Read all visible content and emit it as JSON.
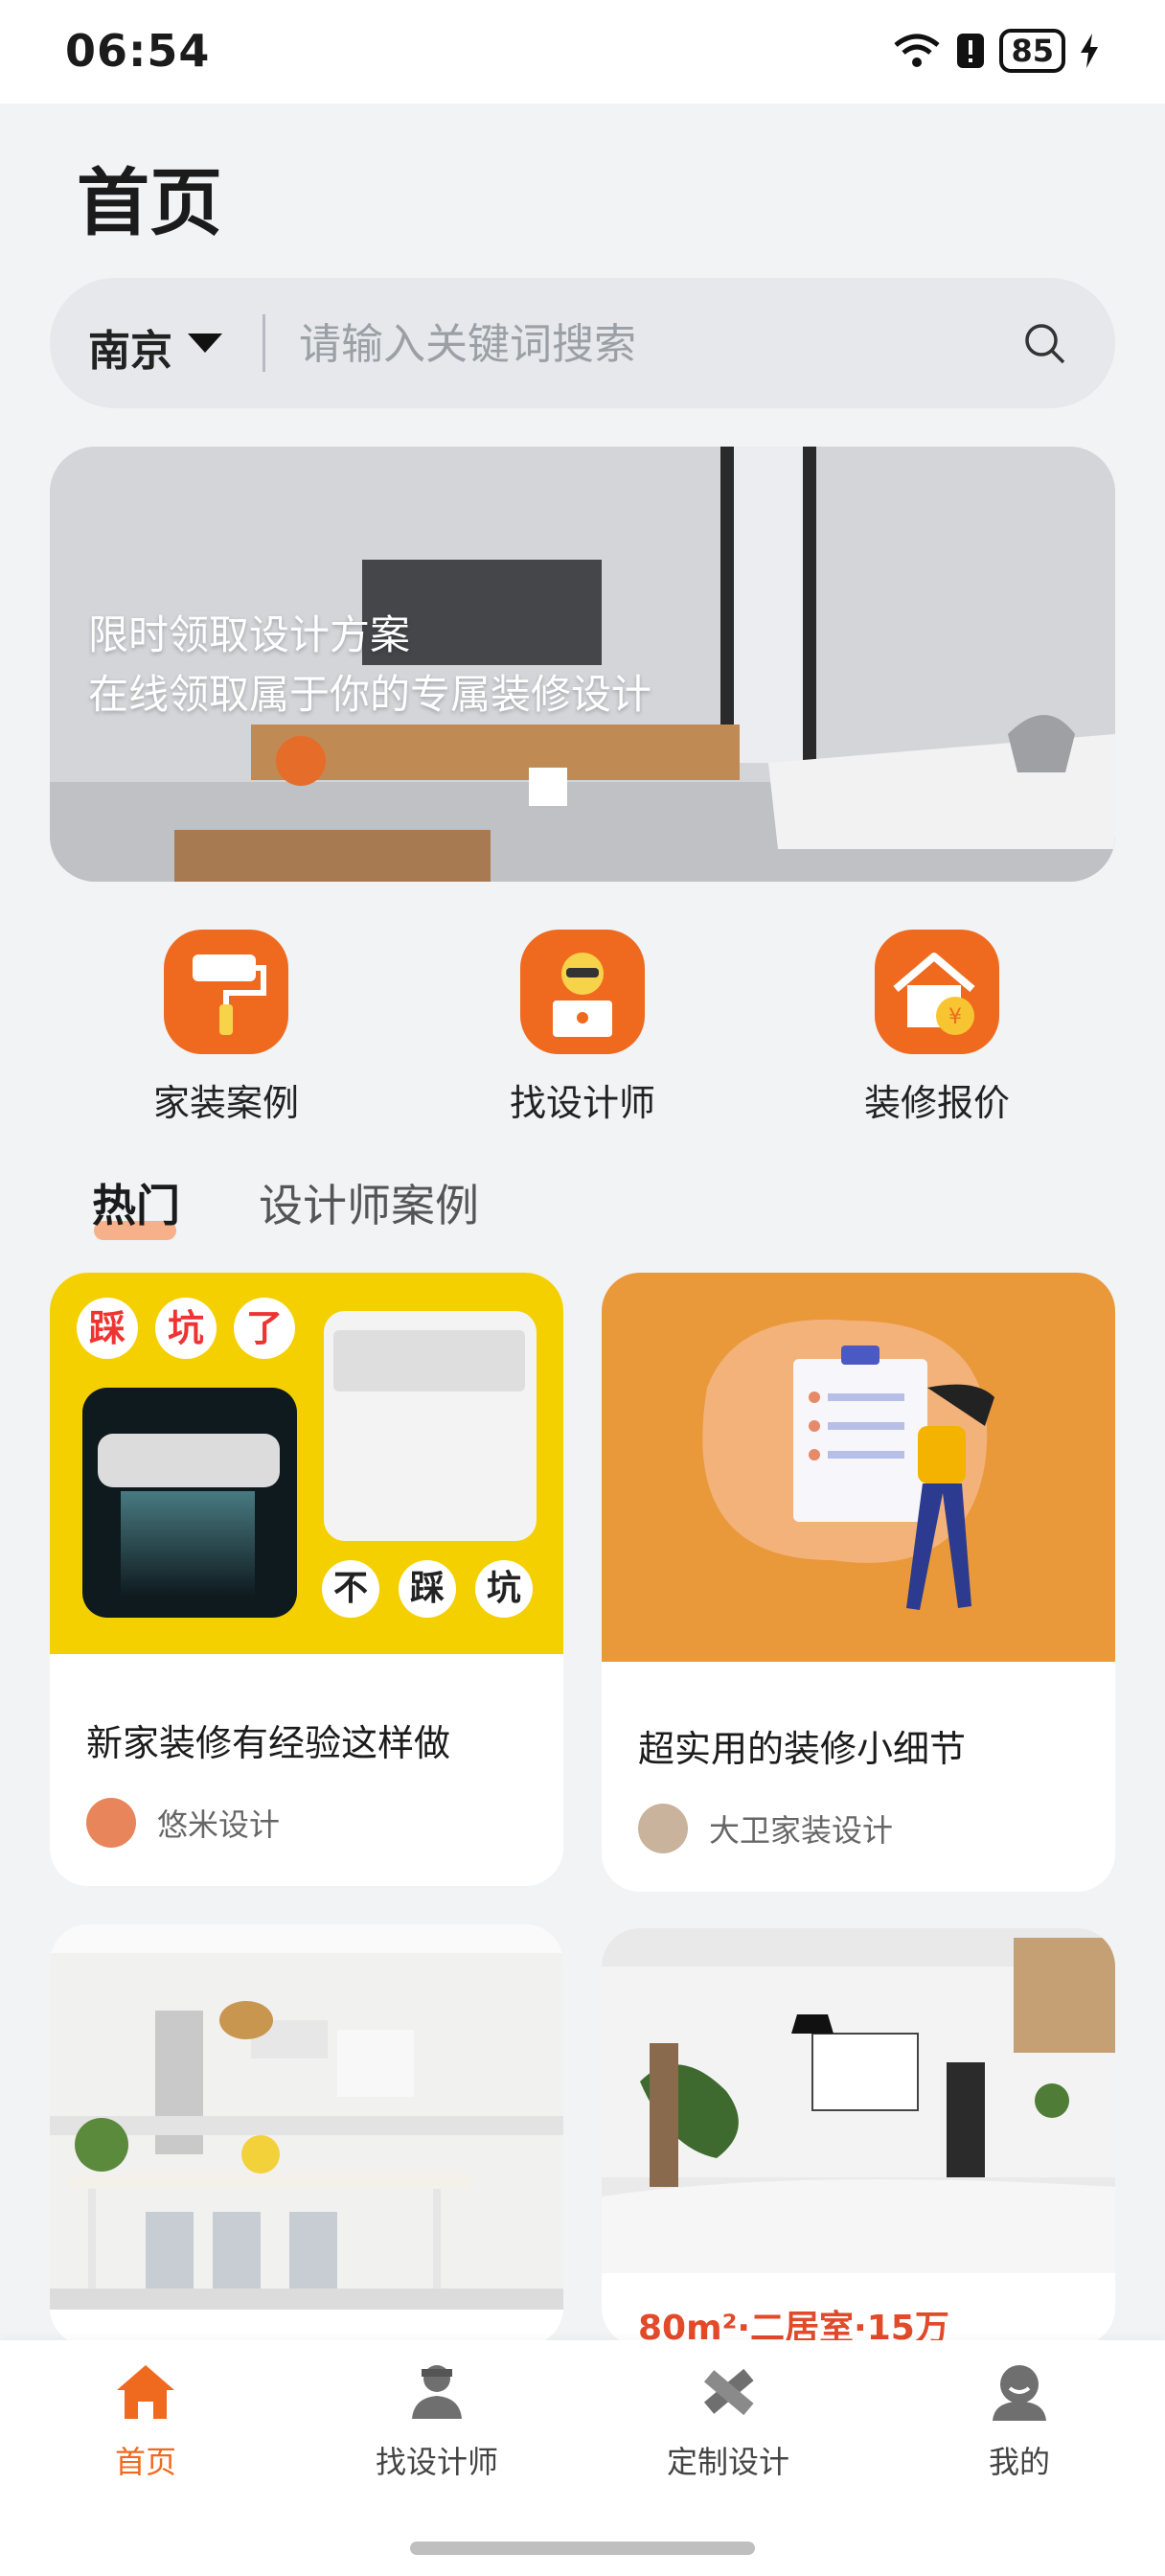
{
  "status_bar": {
    "time": "06:54",
    "battery": "85"
  },
  "page": {
    "title": "首页"
  },
  "search": {
    "city": "南京",
    "placeholder": "请输入关键词搜索"
  },
  "banner": {
    "line1": "限时领取设计方案",
    "line2": "在线领取属于你的专属装修设计"
  },
  "quick_actions": [
    {
      "label": "家装案例",
      "icon": "paint-roller-icon"
    },
    {
      "label": "找设计师",
      "icon": "designer-icon"
    },
    {
      "label": "装修报价",
      "icon": "house-price-icon"
    }
  ],
  "tabs": [
    {
      "label": "热门"
    },
    {
      "label": "设计师案例"
    }
  ],
  "cards": [
    {
      "image_texts": {
        "top": [
          "踩",
          "坑",
          "了"
        ],
        "bottom": [
          "不",
          "踩",
          "坑"
        ]
      },
      "title": "新家装修有经验这样做",
      "author": "悠米设计"
    },
    {
      "title": "超实用的装修小细节",
      "author": "大卫家装设计"
    },
    {
      "title": ""
    },
    {
      "title": "80m²·二居室·15万"
    }
  ],
  "bottom_nav": [
    {
      "label": "首页",
      "icon": "home-icon"
    },
    {
      "label": "找设计师",
      "icon": "designer-person-icon"
    },
    {
      "label": "定制设计",
      "icon": "pencil-ruler-icon"
    },
    {
      "label": "我的",
      "icon": "user-icon"
    }
  ],
  "colors": {
    "accent": "#ef6a1f",
    "card1_bg": "#f5d000",
    "card2_bg": "#e9993a"
  }
}
